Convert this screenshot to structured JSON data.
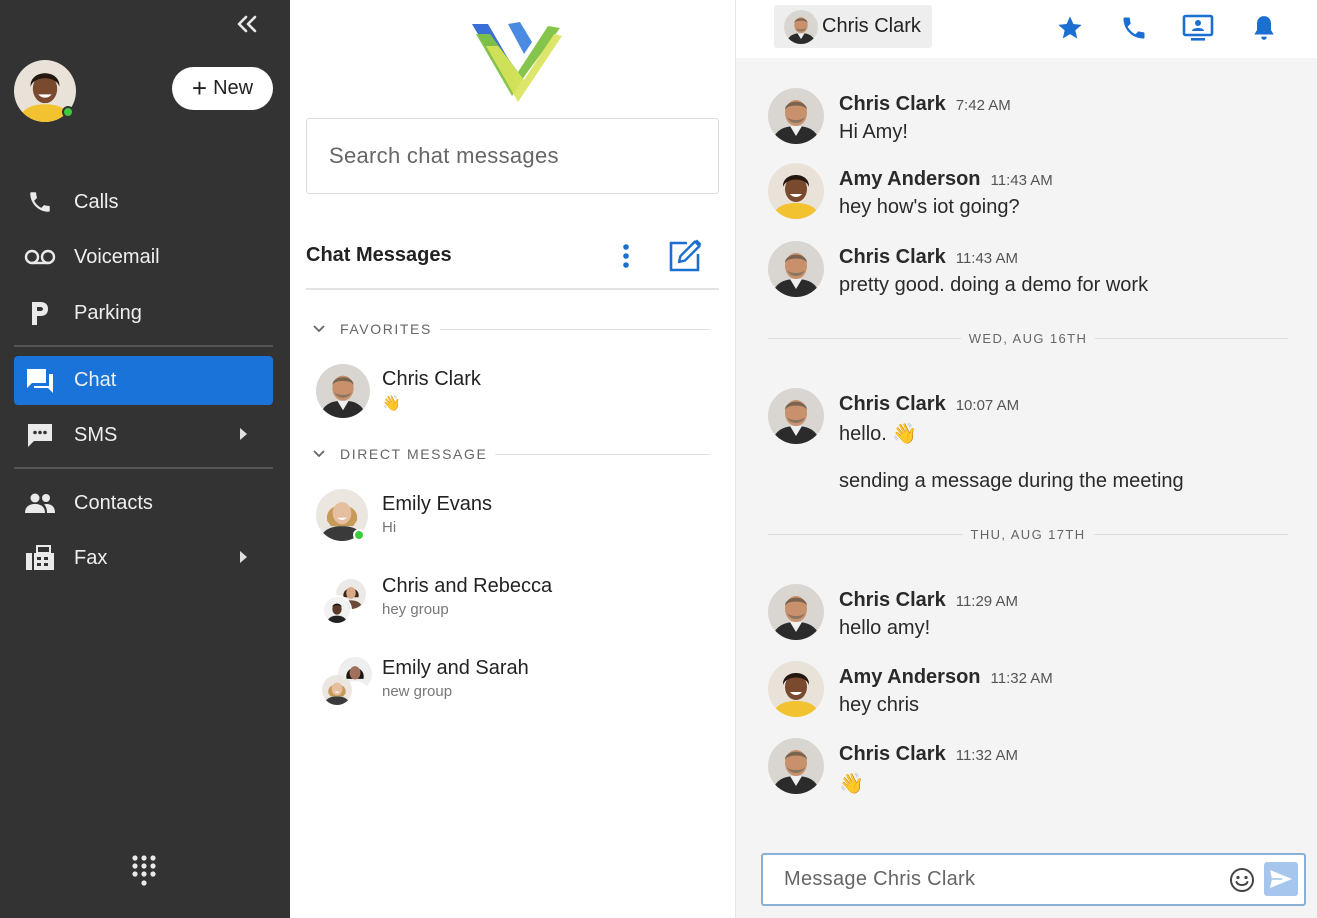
{
  "sidebar": {
    "new_label": "New",
    "items": [
      {
        "label": "Calls",
        "icon": "phone-icon"
      },
      {
        "label": "Voicemail",
        "icon": "voicemail-icon"
      },
      {
        "label": "Parking",
        "icon": "parking-icon"
      },
      {
        "label": "Chat",
        "icon": "chat-icon",
        "active": true
      },
      {
        "label": "SMS",
        "icon": "sms-icon"
      },
      {
        "label": "Contacts",
        "icon": "contacts-icon"
      },
      {
        "label": "Fax",
        "icon": "fax-icon"
      }
    ]
  },
  "list": {
    "search_placeholder": "Search chat messages",
    "title": "Chat Messages",
    "sections": [
      {
        "label": "FAVORITES"
      },
      {
        "label": "DIRECT MESSAGE"
      }
    ],
    "conversations": [
      {
        "name": "Chris Clark",
        "sub": "👋"
      },
      {
        "name": "Emily Evans",
        "sub": "Hi"
      },
      {
        "name": "Chris and Rebecca",
        "sub": "hey group"
      },
      {
        "name": "Emily and Sarah",
        "sub": "new group"
      }
    ]
  },
  "chat": {
    "header_name": "Chris Clark",
    "messages": [
      {
        "name": "Chris Clark",
        "time": "7:42 AM",
        "text": "Hi Amy!",
        "text2": ""
      },
      {
        "name": "Amy Anderson",
        "time": "11:43 AM",
        "text": "hey how's iot going?",
        "text2": ""
      },
      {
        "name": "Chris Clark",
        "time": "11:43 AM",
        "text": "pretty good.  doing a demo for work",
        "text2": ""
      },
      {
        "name": "Chris Clark",
        "time": "10:07 AM",
        "text": "hello. 👋",
        "text2": "sending a message during the meeting"
      },
      {
        "name": "Chris Clark",
        "time": "11:29 AM",
        "text": "hello amy!",
        "text2": ""
      },
      {
        "name": "Amy Anderson",
        "time": "11:32 AM",
        "text": "hey chris",
        "text2": ""
      },
      {
        "name": "Chris Clark",
        "time": "11:32 AM",
        "text": "👋",
        "text2": ""
      }
    ],
    "day_separators": [
      "WED, AUG 16TH",
      "THU, AUG 17TH"
    ],
    "composer_placeholder": "Message Chris Clark"
  },
  "colors": {
    "sidebar_bg": "#333333",
    "active_blue": "#1a73d9",
    "header_icon_blue": "#1a6fd0",
    "online_green": "#3ecb3e"
  }
}
